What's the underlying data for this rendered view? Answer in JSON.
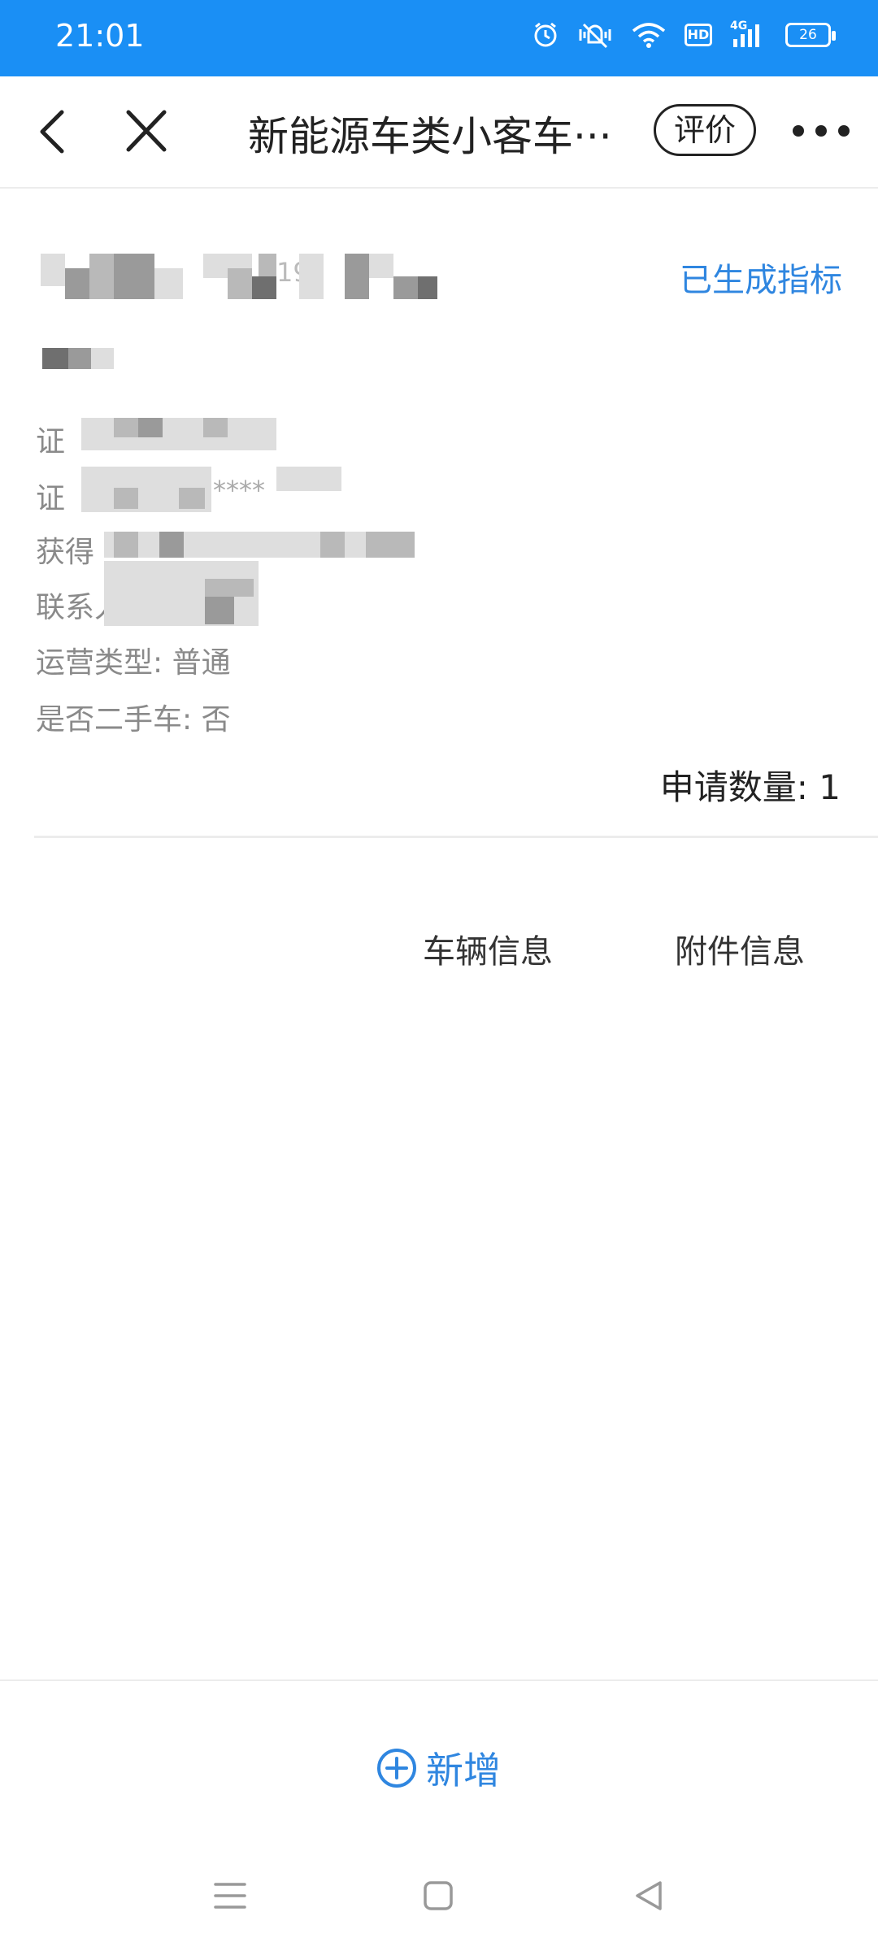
{
  "status_bar": {
    "time": "21:01",
    "battery": "26",
    "network": "4G",
    "hd": "HD",
    "icons": [
      "alarm-icon",
      "mute-vibrate-icon",
      "wifi-icon",
      "hd-icon",
      "signal-icon",
      "battery-icon"
    ]
  },
  "title_bar": {
    "title": "新能源车类小客车···",
    "rate_label": "评价",
    "icons": [
      "back-arrow-icon",
      "close-icon",
      "more-dots-icon"
    ]
  },
  "record": {
    "status": "已生成指标",
    "operation_type": "运营类型: 普通",
    "second_hand": "是否二手车: 否",
    "apply_count": "申请数量: 1",
    "partial_fragments": {
      "name_frag": "19",
      "cert_label_frag": "证",
      "cert2_label_frag": "证",
      "cert2_masked": "****",
      "obtain_label_frag": "获得",
      "contact_label_frag": "联系人"
    }
  },
  "tabs": [
    "车辆信息",
    "附件信息"
  ],
  "footer": {
    "add_label": "新增",
    "add_icon": "plus-circle-icon"
  },
  "nav": [
    "menu-icon",
    "home-icon",
    "back-triangle-icon"
  ],
  "colors": {
    "status_bar": "#1a8ff5",
    "accent": "#2f86e0"
  }
}
